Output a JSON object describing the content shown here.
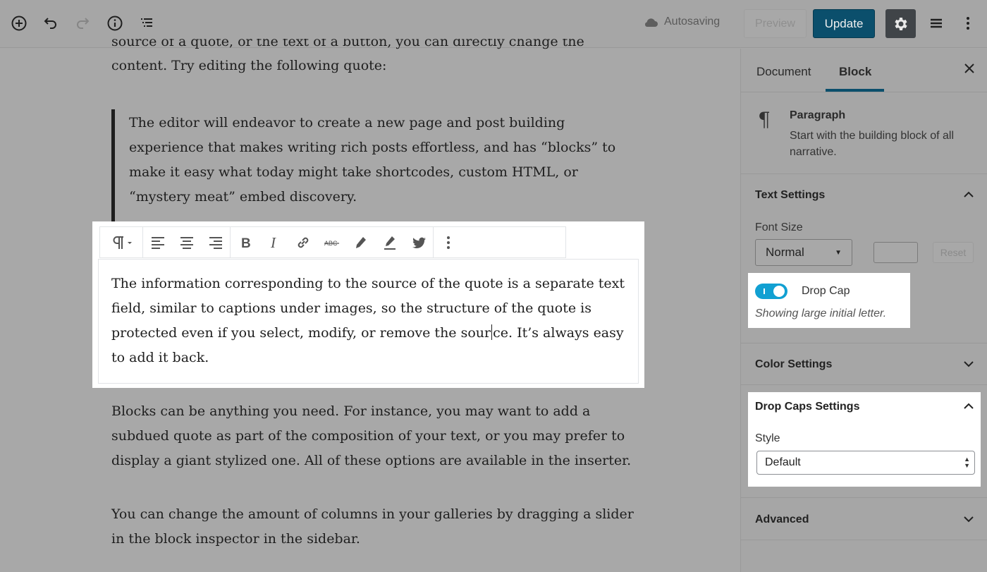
{
  "topbar": {
    "autosave_text": "Autosaving",
    "preview_label": "Preview",
    "update_label": "Update"
  },
  "editor": {
    "paragraph_top_line1": "source of a quote, or the text of a button, you can directly change the",
    "paragraph_top_line2": "content. Try editing the following quote:",
    "quote_text": "The editor will endeavor to create a new page and post building experience that makes writing rich posts effortless, and has “blocks” to make it easy what today might take shortcodes, custom HTML, or “mystery meat” embed discovery.",
    "selected_before_caret": "The information corresponding to the source of the quote is a separate text field, similar to captions under images, so the structure of the quote is protected even if you select, modify, or remove the sour",
    "selected_after_caret": "ce. It’s always easy to add it back.",
    "paragraph_after1": "Blocks can be anything you need. For instance, you may want to add a subdued quote as part of the composition of your text, or you may prefer to display a giant stylized one. All of these options are available in the inserter.",
    "paragraph_after2": "You can change the amount of columns in your galleries by dragging a slider in the block inspector in the sidebar."
  },
  "sidebar": {
    "tabs": [
      {
        "label": "Document",
        "active": false
      },
      {
        "label": "Block",
        "active": true
      }
    ],
    "block_card": {
      "title": "Paragraph",
      "description": "Start with the building block of all narrative."
    },
    "text_settings": {
      "title": "Text Settings",
      "font_size_label": "Font Size",
      "font_size_value": "Normal",
      "reset_label": "Reset",
      "drop_cap_label": "Drop Cap",
      "drop_cap_on": true,
      "drop_cap_help": "Showing large initial letter."
    },
    "color_settings": {
      "title": "Color Settings"
    },
    "drop_caps_settings": {
      "title": "Drop Caps Settings",
      "style_label": "Style",
      "style_value": "Default"
    },
    "advanced": {
      "title": "Advanced"
    }
  },
  "colors": {
    "accent": "#0b4f6c",
    "toggle_on": "#11a0d2"
  }
}
